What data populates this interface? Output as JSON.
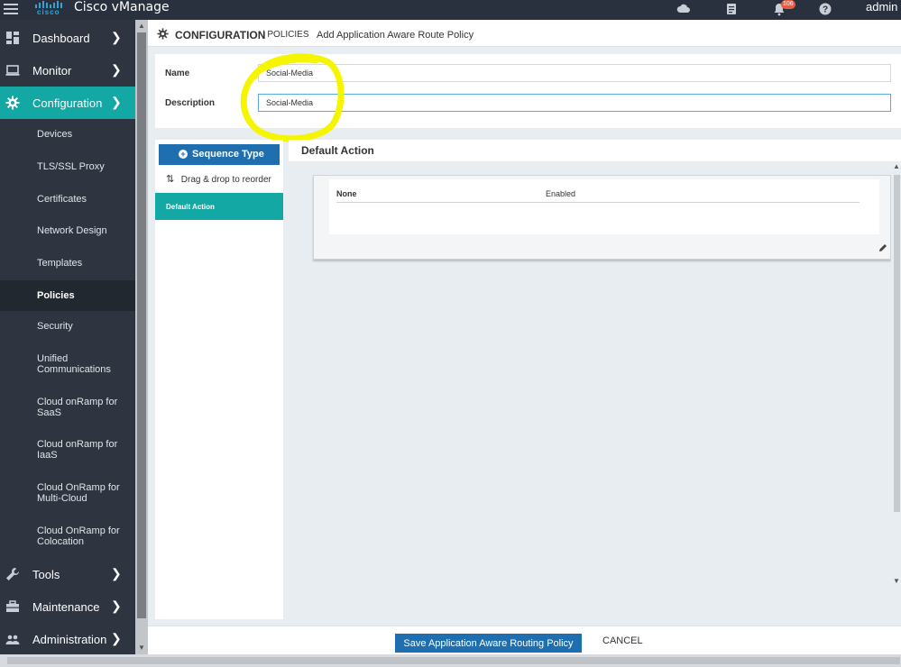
{
  "topbar": {
    "brand_text": "cisco",
    "app_title": "Cisco vManage",
    "notification_count": "106",
    "user": "admin",
    "icons": [
      "menu-icon",
      "cloud-icon",
      "clipboard-icon",
      "bell-icon",
      "help-icon"
    ]
  },
  "sidebar": {
    "items": [
      {
        "label": "Dashboard",
        "icon": "dashboard-icon"
      },
      {
        "label": "Monitor",
        "icon": "monitor-icon"
      },
      {
        "label": "Configuration",
        "icon": "gear-icon",
        "active": true
      },
      {
        "label": "Tools",
        "icon": "wrench-icon"
      },
      {
        "label": "Maintenance",
        "icon": "toolbox-icon"
      },
      {
        "label": "Administration",
        "icon": "users-icon"
      }
    ],
    "sub_items": [
      {
        "label": "Devices"
      },
      {
        "label": "TLS/SSL Proxy"
      },
      {
        "label": "Certificates"
      },
      {
        "label": "Network Design"
      },
      {
        "label": "Templates"
      },
      {
        "label": "Policies",
        "active": true
      },
      {
        "label": "Security"
      },
      {
        "label": "Unified Communications"
      },
      {
        "label": "Cloud onRamp for SaaS"
      },
      {
        "label": "Cloud onRamp for IaaS"
      },
      {
        "label": "Cloud OnRamp for Multi-Cloud"
      },
      {
        "label": "Cloud OnRamp for Colocation"
      }
    ]
  },
  "header": {
    "section": "CONFIGURATION",
    "subsection": "| POLICIES",
    "page": "Add Application Aware Route Policy"
  },
  "form": {
    "name_label": "Name",
    "name_value": "Social-Media",
    "description_label": "Description",
    "description_value": "Social-Media"
  },
  "sequence": {
    "button_label": "Sequence Type",
    "drag_label": "Drag & drop to reorder",
    "default_item": "Default Action"
  },
  "default_action": {
    "title": "Default Action",
    "col1": "None",
    "col2": "Enabled"
  },
  "footer": {
    "save_label": "Save Application Aware Routing Policy",
    "cancel_label": "CANCEL"
  },
  "colors": {
    "accent_teal": "#14a8a4",
    "primary_blue": "#1f6eaf",
    "sidebar_bg": "#2e3540",
    "topbar_bg": "#28313d",
    "highlight_yellow": "#f5f500",
    "badge_red": "#e55d44"
  }
}
